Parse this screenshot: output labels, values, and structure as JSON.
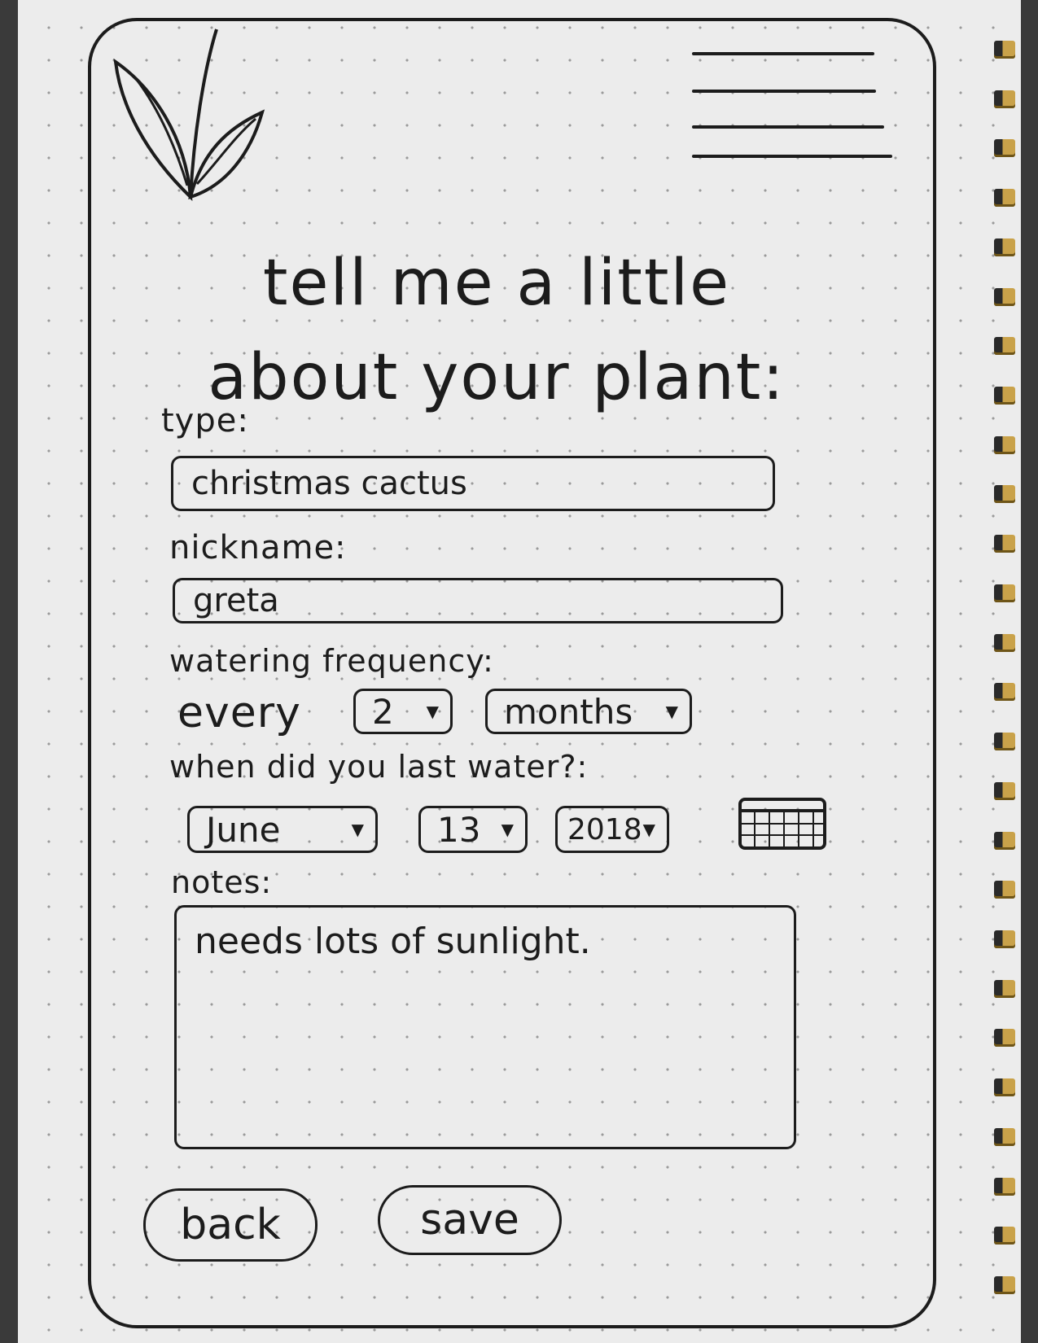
{
  "header": {
    "logo_icon": "plant-sprout-icon",
    "menu_icon": "hamburger-menu-icon"
  },
  "title": {
    "line1": "tell me a little",
    "line2": "about your plant:"
  },
  "form": {
    "type": {
      "label": "type:",
      "value": "christmas cactus"
    },
    "nickname": {
      "label": "nickname:",
      "value": "greta"
    },
    "watering": {
      "label": "watering frequency:",
      "prefix": "every",
      "count": "2",
      "unit": "months"
    },
    "last_watered": {
      "label": "when did you last water?:",
      "month": "June",
      "day": "13",
      "year": "2018",
      "calendar_icon": "calendar-icon"
    },
    "notes": {
      "label": "notes:",
      "value": "needs lots of sunlight."
    }
  },
  "actions": {
    "back_label": "back",
    "save_label": "save"
  }
}
